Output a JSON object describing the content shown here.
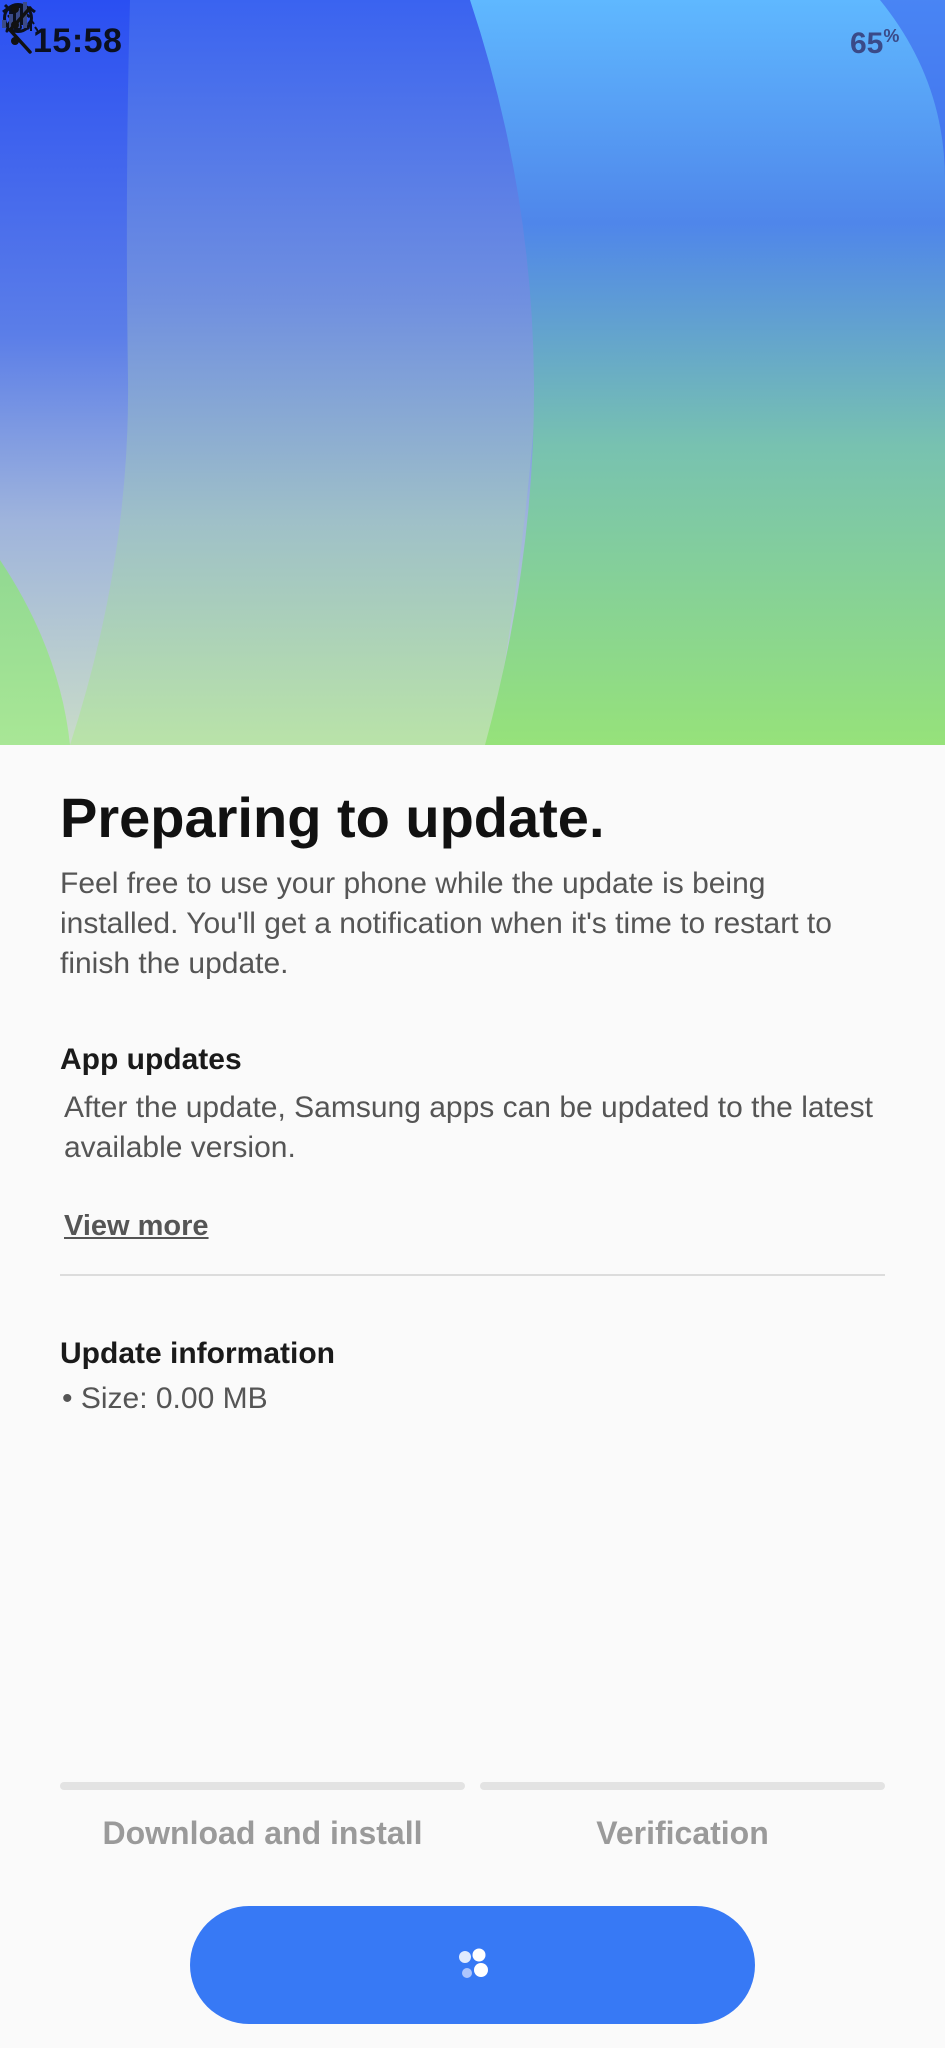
{
  "status_bar": {
    "time": "15:58",
    "battery_level": "65",
    "battery_unit": "%",
    "icons": [
      "whatsapp-icon",
      "mute-icon",
      "wifi-icon",
      "signal-icon"
    ]
  },
  "toolbar": {
    "back_icon": "chevron-left-icon",
    "more_icon": "more-vertical-icon"
  },
  "main": {
    "title": "Preparing to update.",
    "description": "Feel free to use your phone while the update is being installed. You'll get a notification when it's time to restart to finish the update.",
    "app_updates": {
      "heading": "App updates",
      "text": "After the update, Samsung apps can be updated to the latest available version.",
      "link": "View more"
    },
    "update_info": {
      "heading": "Update information",
      "size_item": "• Size: 0.00 MB"
    }
  },
  "progress": {
    "steps": [
      {
        "label": "Download and install",
        "progress": 0
      },
      {
        "label": "Verification",
        "progress": 0
      }
    ]
  },
  "action_button": {
    "state_icon": "loading-dots-icon"
  },
  "colors": {
    "accent": "#3779f5",
    "hero_blue": "#2d55f0",
    "hero_green": "#93e07c",
    "track": "#e3e3e3"
  }
}
